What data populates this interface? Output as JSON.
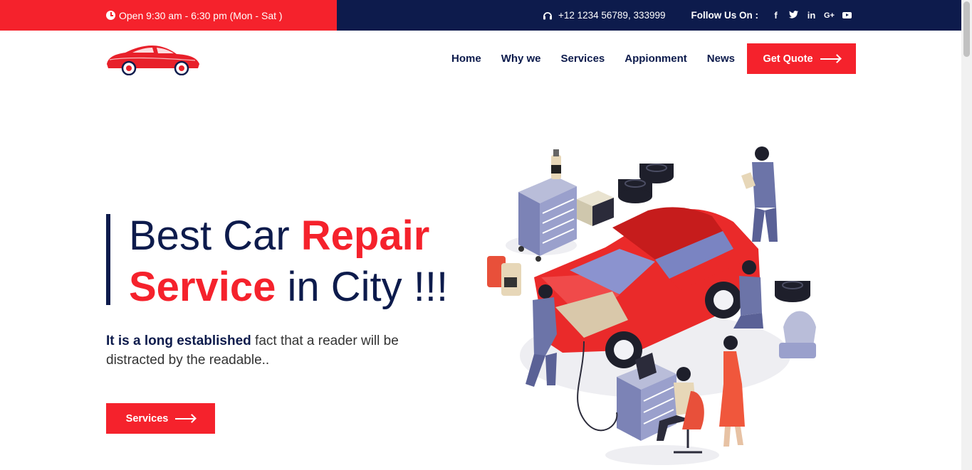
{
  "topbar": {
    "hours": "Open 9:30 am - 6:30 pm (Mon - Sat )",
    "phone": "+12 1234 56789, 333999",
    "follow_label": "Follow Us On :",
    "social": [
      {
        "icon": "facebook-icon",
        "glyph": "f"
      },
      {
        "icon": "twitter-icon",
        "glyph": "t"
      },
      {
        "icon": "linkedin-icon",
        "glyph": "in"
      },
      {
        "icon": "google-plus-icon",
        "glyph": "G+"
      },
      {
        "icon": "youtube-icon",
        "glyph": ""
      }
    ]
  },
  "nav": {
    "items": [
      "Home",
      "Why we",
      "Services",
      "Appionment",
      "News"
    ],
    "quote_label": "Get Quote"
  },
  "hero": {
    "title_part1": "Best Car ",
    "title_red1": "Repair",
    "title_red2": "Service",
    "title_part2": " in City !!!",
    "text_bold": "It is a long established",
    "text_rest": " fact that a reader will be distracted by the readable..",
    "button_label": "Services"
  },
  "colors": {
    "accent": "#f5222c",
    "navy": "#0d1b4c"
  }
}
